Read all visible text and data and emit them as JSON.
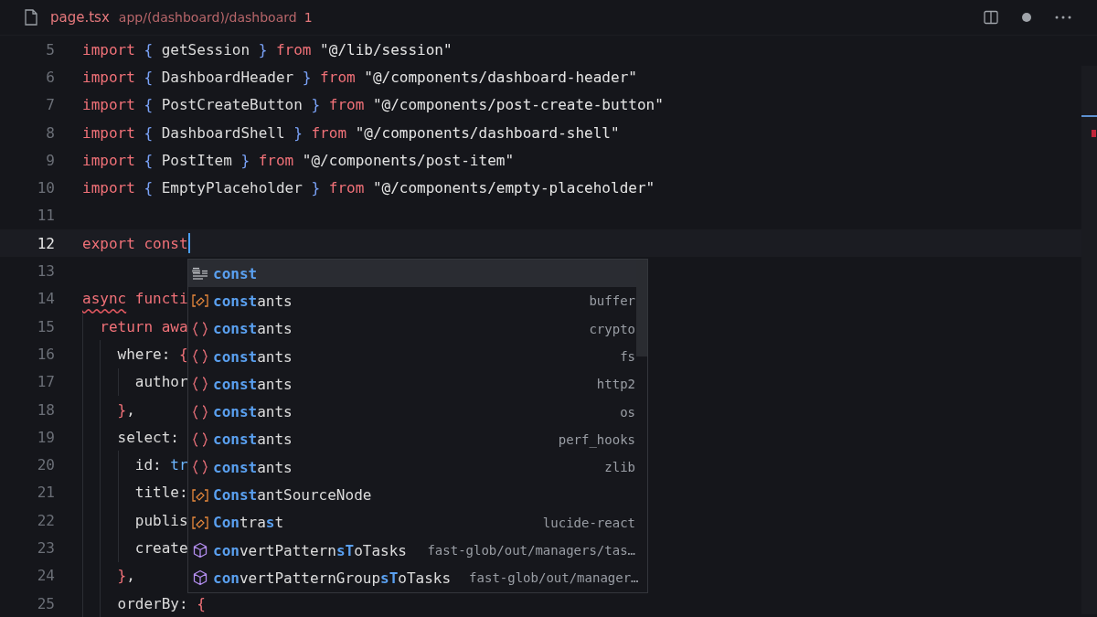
{
  "tab": {
    "file": "page.tsx",
    "path": "app/(dashboard)/dashboard",
    "problems": "1",
    "unsaved": true
  },
  "lines": [
    {
      "number": "5",
      "current": false,
      "tokens": [
        {
          "kind": "kw",
          "text": "import "
        },
        {
          "kind": "brace1",
          "text": "{"
        },
        {
          "kind": "id",
          "text": " getSession "
        },
        {
          "kind": "brace1",
          "text": "}"
        },
        {
          "kind": "kw",
          "text": " from "
        },
        {
          "kind": "str",
          "text": "\"@/lib/session\""
        }
      ]
    },
    {
      "number": "6",
      "current": false,
      "tokens": [
        {
          "kind": "kw",
          "text": "import "
        },
        {
          "kind": "brace1",
          "text": "{"
        },
        {
          "kind": "id",
          "text": " DashboardHeader "
        },
        {
          "kind": "brace1",
          "text": "}"
        },
        {
          "kind": "kw",
          "text": " from "
        },
        {
          "kind": "str",
          "text": "\"@/components/dashboard-header\""
        }
      ]
    },
    {
      "number": "7",
      "current": false,
      "tokens": [
        {
          "kind": "kw",
          "text": "import "
        },
        {
          "kind": "brace1",
          "text": "{"
        },
        {
          "kind": "id",
          "text": " PostCreateButton "
        },
        {
          "kind": "brace1",
          "text": "}"
        },
        {
          "kind": "kw",
          "text": " from "
        },
        {
          "kind": "str",
          "text": "\"@/components/post-create-button\""
        }
      ]
    },
    {
      "number": "8",
      "current": false,
      "tokens": [
        {
          "kind": "kw",
          "text": "import "
        },
        {
          "kind": "brace1",
          "text": "{"
        },
        {
          "kind": "id",
          "text": " DashboardShell "
        },
        {
          "kind": "brace1",
          "text": "}"
        },
        {
          "kind": "kw",
          "text": " from "
        },
        {
          "kind": "str",
          "text": "\"@/components/dashboard-shell\""
        }
      ]
    },
    {
      "number": "9",
      "current": false,
      "tokens": [
        {
          "kind": "kw",
          "text": "import "
        },
        {
          "kind": "brace1",
          "text": "{"
        },
        {
          "kind": "id",
          "text": " PostItem "
        },
        {
          "kind": "brace1",
          "text": "}"
        },
        {
          "kind": "kw",
          "text": " from "
        },
        {
          "kind": "str",
          "text": "\"@/components/post-item\""
        }
      ]
    },
    {
      "number": "10",
      "current": false,
      "tokens": [
        {
          "kind": "kw",
          "text": "import "
        },
        {
          "kind": "brace1",
          "text": "{"
        },
        {
          "kind": "id",
          "text": " EmptyPlaceholder "
        },
        {
          "kind": "brace1",
          "text": "}"
        },
        {
          "kind": "kw",
          "text": " from "
        },
        {
          "kind": "str",
          "text": "\"@/components/empty-placeholder\""
        }
      ]
    },
    {
      "number": "11",
      "current": false
    },
    {
      "number": "12",
      "current": true,
      "tokens": [
        {
          "kind": "kw",
          "text": "export const"
        }
      ]
    },
    {
      "number": "13",
      "current": false
    },
    {
      "number": "14",
      "current": false,
      "tokens": [
        {
          "kind": "kw",
          "text": "async",
          "error": true
        },
        {
          "kind": "kw",
          "text": " functi"
        }
      ]
    },
    {
      "number": "15",
      "current": false,
      "tokens": [
        {
          "kind": "kw",
          "text": "  return awa"
        }
      ]
    },
    {
      "number": "16",
      "current": false,
      "tokens": [
        {
          "kind": "id",
          "text": "    where: "
        },
        {
          "kind": "brace2",
          "text": "{"
        }
      ]
    },
    {
      "number": "17",
      "current": false,
      "tokens": [
        {
          "kind": "id",
          "text": "      author"
        }
      ]
    },
    {
      "number": "18",
      "current": false,
      "tokens": [
        {
          "kind": "brace2",
          "text": "    }"
        },
        {
          "kind": "id",
          "text": ","
        }
      ]
    },
    {
      "number": "19",
      "current": false,
      "tokens": [
        {
          "kind": "id",
          "text": "    select:"
        }
      ]
    },
    {
      "number": "20",
      "current": false,
      "tokens": [
        {
          "kind": "id",
          "text": "      id: "
        },
        {
          "kind": "lit",
          "text": "tr"
        }
      ]
    },
    {
      "number": "21",
      "current": false,
      "tokens": [
        {
          "kind": "id",
          "text": "      title:"
        }
      ]
    },
    {
      "number": "22",
      "current": false,
      "tokens": [
        {
          "kind": "id",
          "text": "      publis"
        }
      ]
    },
    {
      "number": "23",
      "current": false,
      "tokens": [
        {
          "kind": "id",
          "text": "      create"
        }
      ]
    },
    {
      "number": "24",
      "current": false,
      "tokens": [
        {
          "kind": "brace2",
          "text": "    }"
        },
        {
          "kind": "id",
          "text": ","
        }
      ]
    },
    {
      "number": "25",
      "current": false,
      "tokens": [
        {
          "kind": "id",
          "text": "    orderBy: "
        },
        {
          "kind": "brace2",
          "text": "{"
        }
      ]
    }
  ],
  "suggestions": [
    {
      "kind": "keyword",
      "label": "**const**",
      "selected": true
    },
    {
      "kind": "variable",
      "label": "**const**ants",
      "detail": "buffer",
      "selected": false
    },
    {
      "kind": "module",
      "label": "**const**ants",
      "detail": "crypto",
      "selected": false
    },
    {
      "kind": "module",
      "label": "**const**ants",
      "detail": "fs",
      "selected": false
    },
    {
      "kind": "module",
      "label": "**const**ants",
      "detail": "http2",
      "selected": false
    },
    {
      "kind": "module",
      "label": "**const**ants",
      "detail": "os",
      "selected": false
    },
    {
      "kind": "module",
      "label": "**const**ants",
      "detail": "perf_hooks",
      "selected": false
    },
    {
      "kind": "module",
      "label": "**const**ants",
      "detail": "zlib",
      "selected": false
    },
    {
      "kind": "variable",
      "label": "**Const**antSourceNode",
      "selected": false
    },
    {
      "kind": "variable",
      "label": "**Con**tra**s**t",
      "detail": "lucide-react",
      "selected": false
    },
    {
      "kind": "method",
      "label": "**con**vertPattern**sT**oTasks",
      "detail": "fast-glob/out/managers/tas…",
      "selected": false
    },
    {
      "kind": "method",
      "label": "**con**vertPatternGroup**sT**oTasks",
      "detail": "fast-glob/out/manager…",
      "selected": false
    }
  ]
}
